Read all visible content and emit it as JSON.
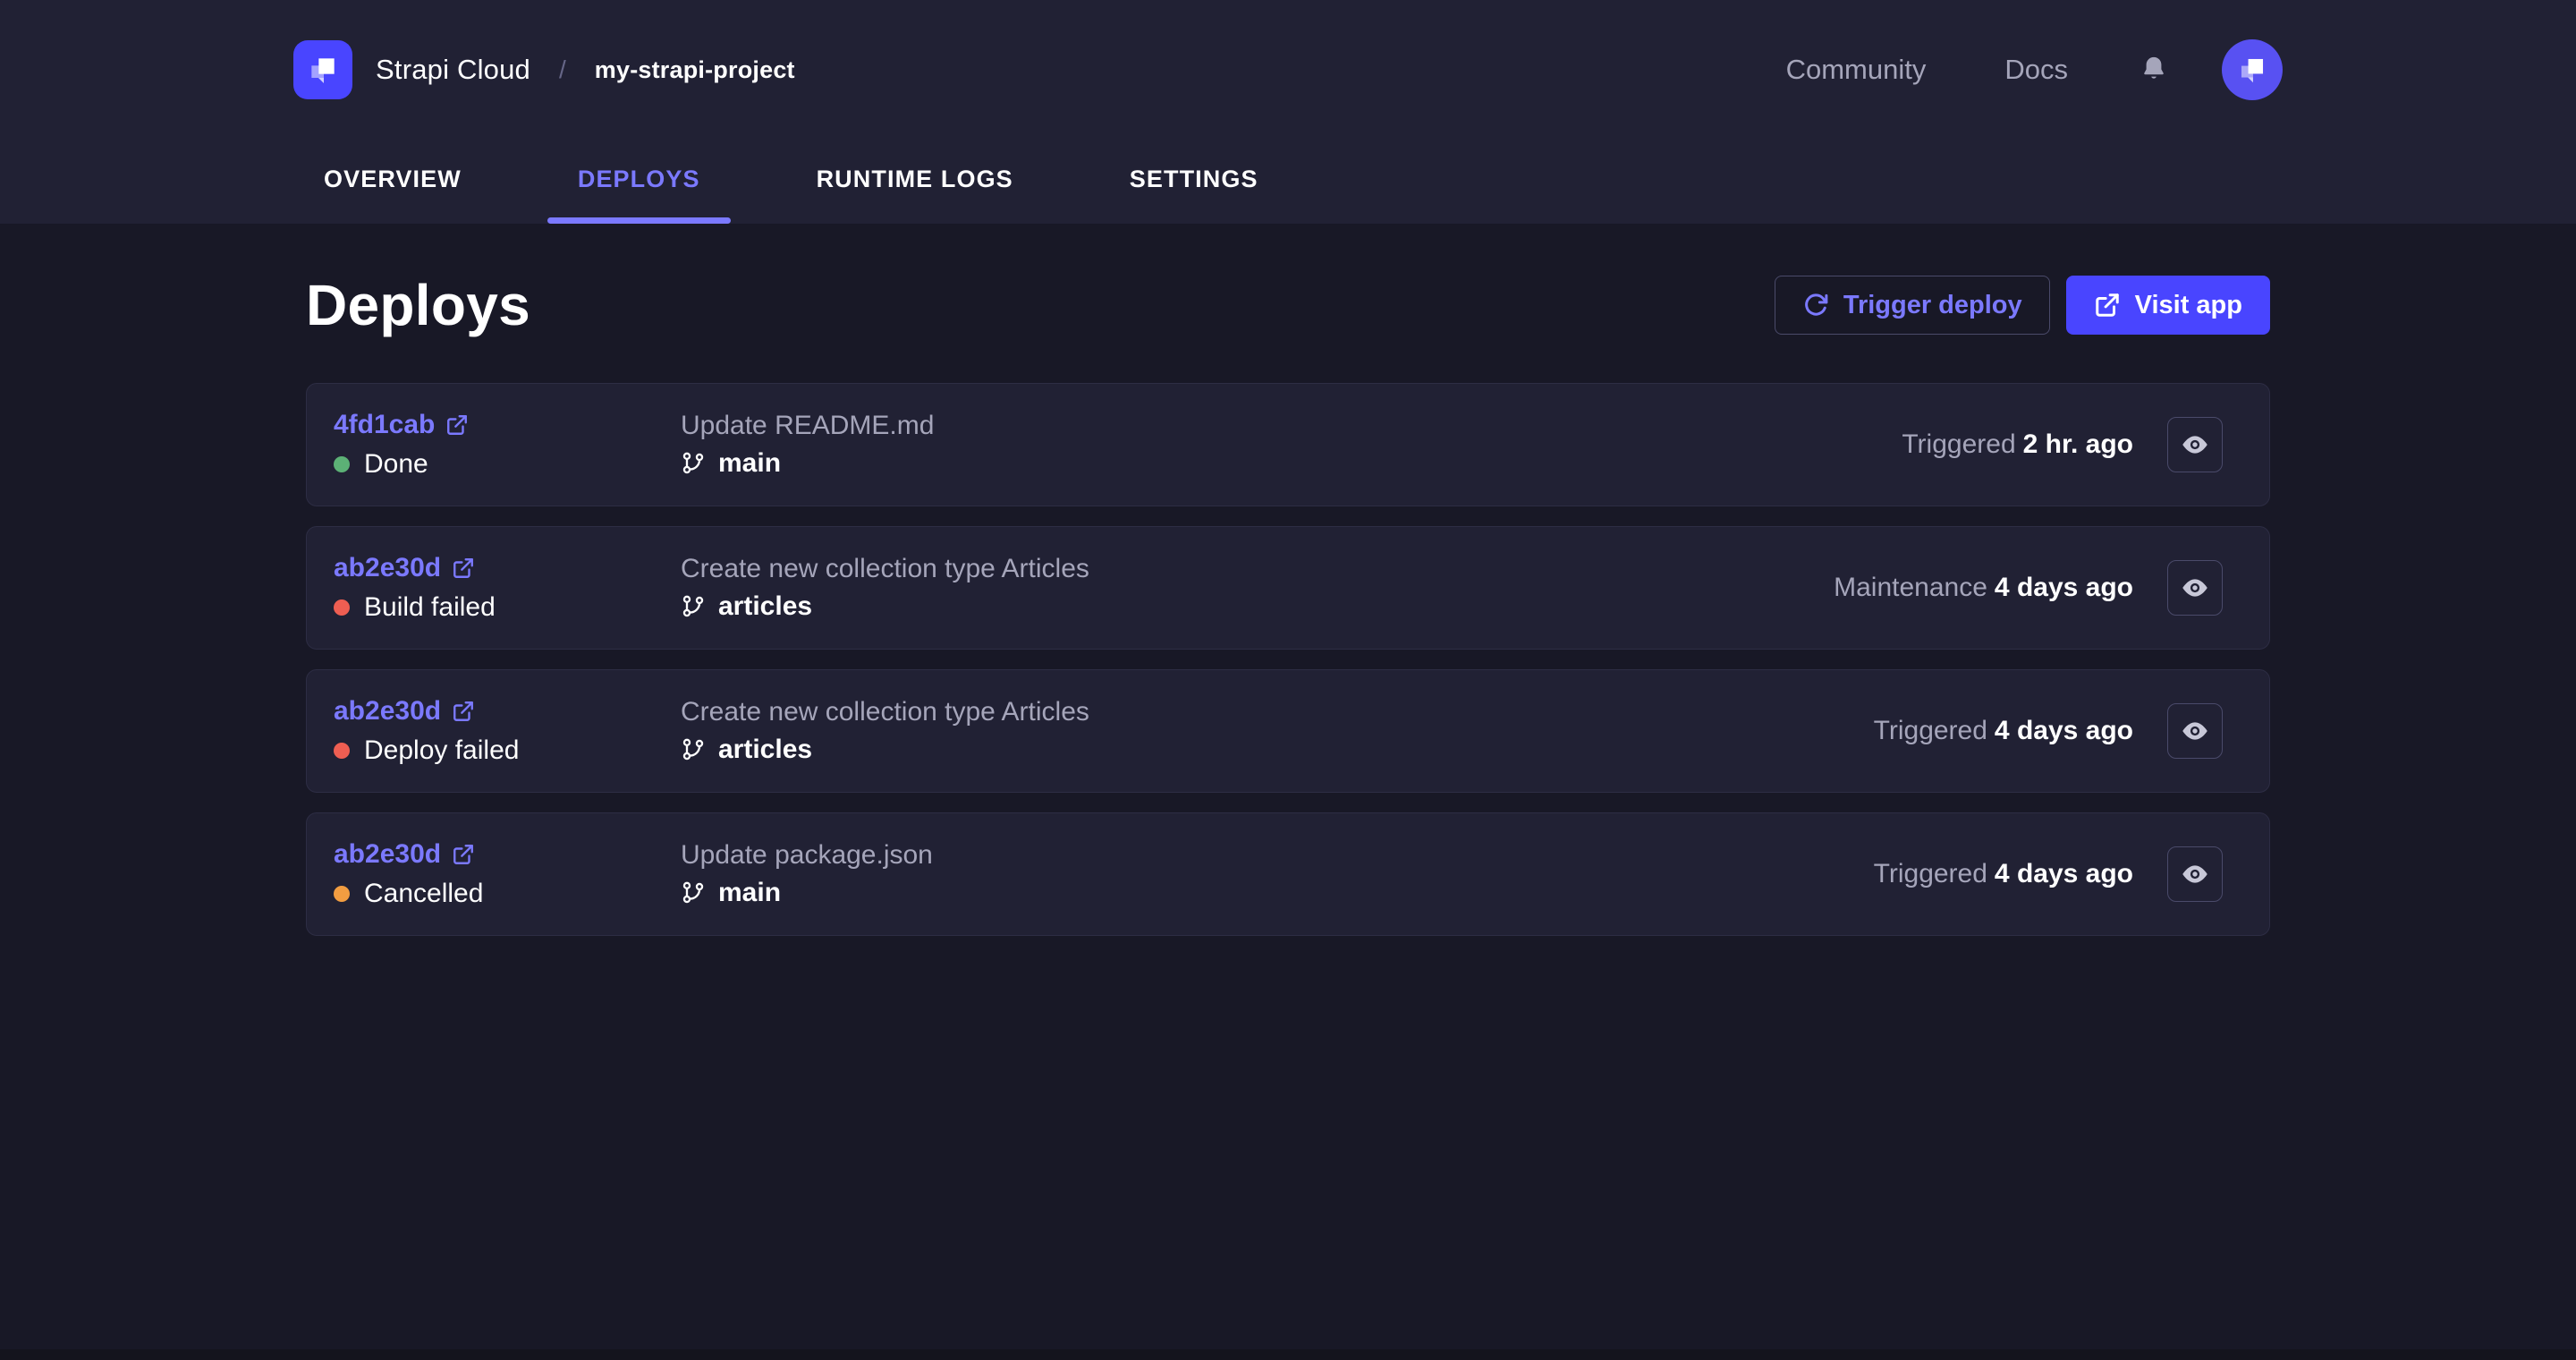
{
  "header": {
    "brand": "Strapi Cloud",
    "breadcrumb_separator": "/",
    "project_name": "my-strapi-project",
    "nav": {
      "community": "Community",
      "docs": "Docs"
    },
    "icons": {
      "logo": "strapi-logo",
      "bell": "notification-bell",
      "avatar": "strapi-avatar"
    }
  },
  "tabs": [
    {
      "label": "OVERVIEW",
      "active": false
    },
    {
      "label": "DEPLOYS",
      "active": true
    },
    {
      "label": "RUNTIME LOGS",
      "active": false
    },
    {
      "label": "SETTINGS",
      "active": false
    }
  ],
  "page": {
    "title": "Deploys",
    "trigger_deploy_label": "Trigger deploy",
    "visit_app_label": "Visit app"
  },
  "deploys": [
    {
      "commit": "4fd1cab",
      "status": "Done",
      "status_color": "#5cb176",
      "message": "Update README.md",
      "branch": "main",
      "trigger_type": "Triggered",
      "time": "2 hr. ago"
    },
    {
      "commit": "ab2e30d",
      "status": "Build failed",
      "status_color": "#ee5e52",
      "message": "Create new collection type Articles",
      "branch": "articles",
      "trigger_type": "Maintenance",
      "time": "4 days ago"
    },
    {
      "commit": "ab2e30d",
      "status": "Deploy failed",
      "status_color": "#ee5e52",
      "message": "Create new collection type Articles",
      "branch": "articles",
      "trigger_type": "Triggered",
      "time": "4 days ago"
    },
    {
      "commit": "ab2e30d",
      "status": "Cancelled",
      "status_color": "#f29d41",
      "message": "Update package.json",
      "branch": "main",
      "trigger_type": "Triggered",
      "time": "4 days ago"
    }
  ],
  "colors": {
    "page_background": "#181826",
    "surface": "#212134",
    "primary": "#4945ff",
    "primary_light": "#7b79ff",
    "text_secondary": "#a5a5ba",
    "success": "#5cb176",
    "danger": "#ee5e52",
    "warning": "#f29d41"
  }
}
